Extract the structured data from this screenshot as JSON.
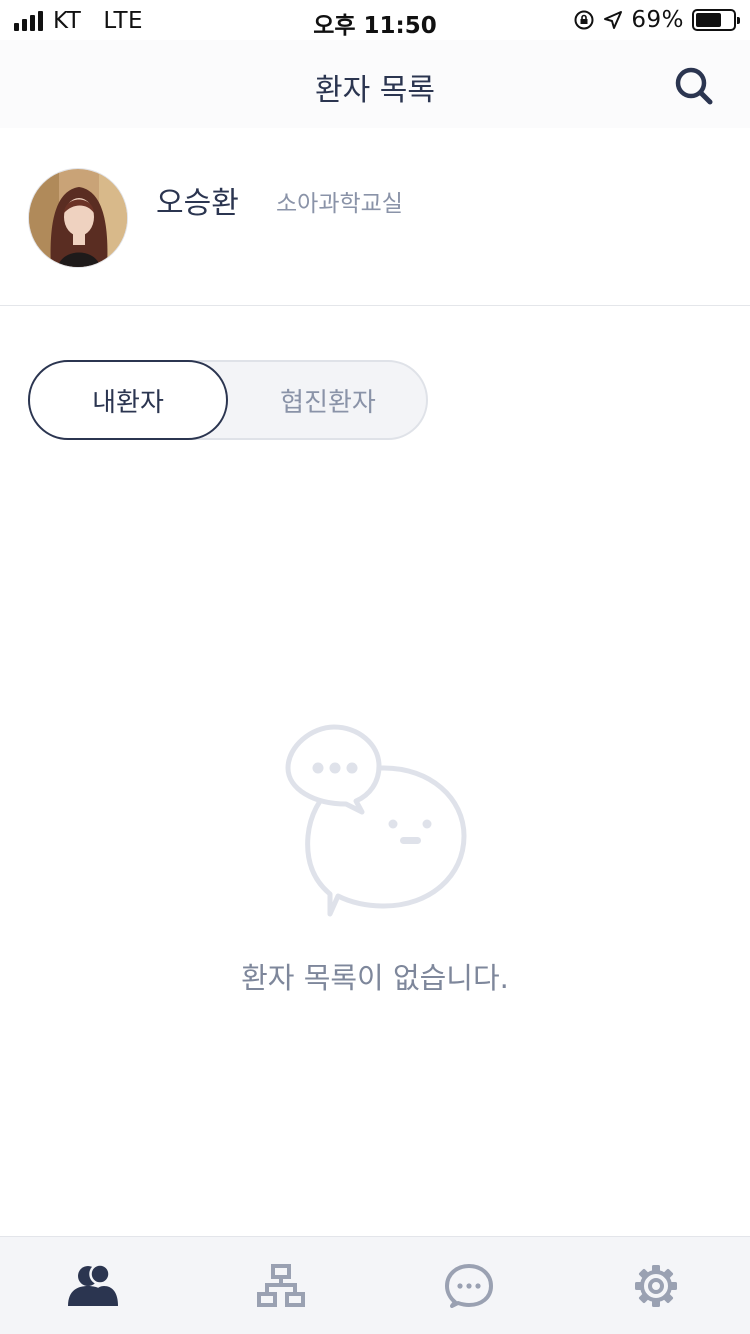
{
  "status_bar": {
    "carrier": "KT",
    "network": "LTE",
    "time": "오후 11:50",
    "battery_percent": "69%",
    "battery_level": 0.69
  },
  "header": {
    "title": "환자 목록",
    "search_icon": "search-icon"
  },
  "profile": {
    "name": "오승환",
    "department": "소아과학교실"
  },
  "segment": {
    "options": [
      "내환자",
      "협진환자"
    ],
    "selected": "내환자"
  },
  "empty_state": {
    "icon": "chat-bubbles-icon",
    "message": "환자 목록이 없습니다."
  },
  "tabbar": {
    "items": [
      {
        "icon": "patients-icon",
        "active": true
      },
      {
        "icon": "organization-icon",
        "active": false
      },
      {
        "icon": "chat-icon",
        "active": false
      },
      {
        "icon": "settings-icon",
        "active": false
      }
    ]
  },
  "colors": {
    "primary": "#2b3550",
    "muted": "#8a93a8",
    "inactive_icon": "#9aa1b2",
    "illustration": "#dfe2ea"
  }
}
